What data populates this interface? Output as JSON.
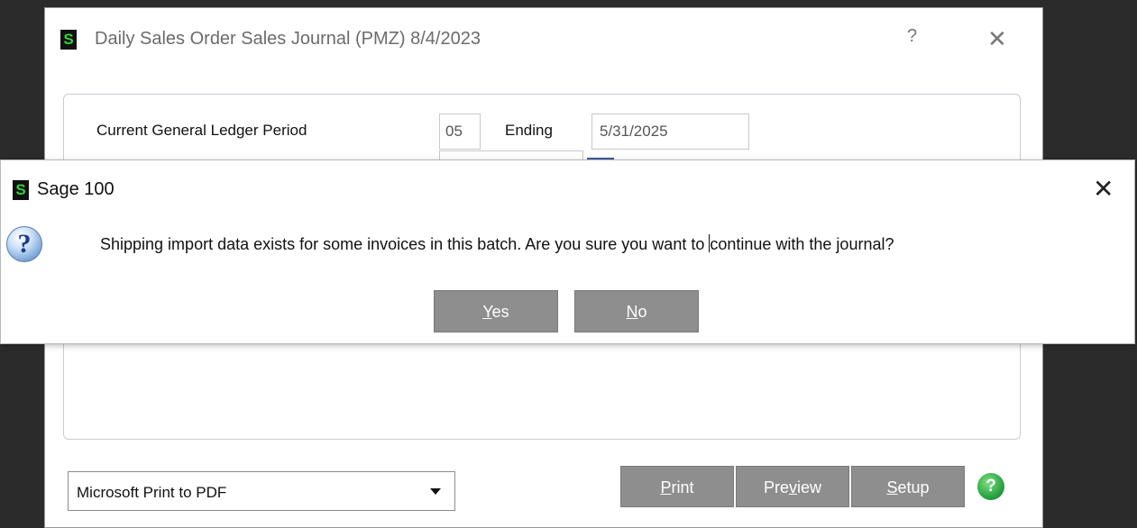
{
  "main_window": {
    "title": "Daily Sales Order Sales Journal (PMZ) 8/4/2023",
    "help_glyph": "?",
    "close_glyph": "✕",
    "logo_letter": "S"
  },
  "gl": {
    "label": "Current General Ledger Period",
    "period": "05",
    "ending_label": "Ending",
    "ending_date": "5/31/2025"
  },
  "printer": {
    "selected": "Microsoft Print to PDF"
  },
  "buttons": {
    "print_ul": "P",
    "print_rest": "rint",
    "preview_a": "Pre",
    "preview_ul": "v",
    "preview_b": "iew",
    "setup_ul": "S",
    "setup_rest": "etup",
    "help_glyph": "?"
  },
  "dialog": {
    "logo_letter": "S",
    "title": "Sage 100",
    "close_glyph": "✕",
    "icon_glyph": "?",
    "message_before_cursor": "Shipping import data exists for some invoices in this batch. Are you sure you want to ",
    "message_after_cursor": "continue with the journal?",
    "yes_ul": "Y",
    "yes_rest": "es",
    "no_ul": "N",
    "no_rest": "o"
  },
  "colors": {
    "logo_green": "#35d23a",
    "button_gray": "#8e8e8e",
    "help_green": "#1f9a3a"
  }
}
